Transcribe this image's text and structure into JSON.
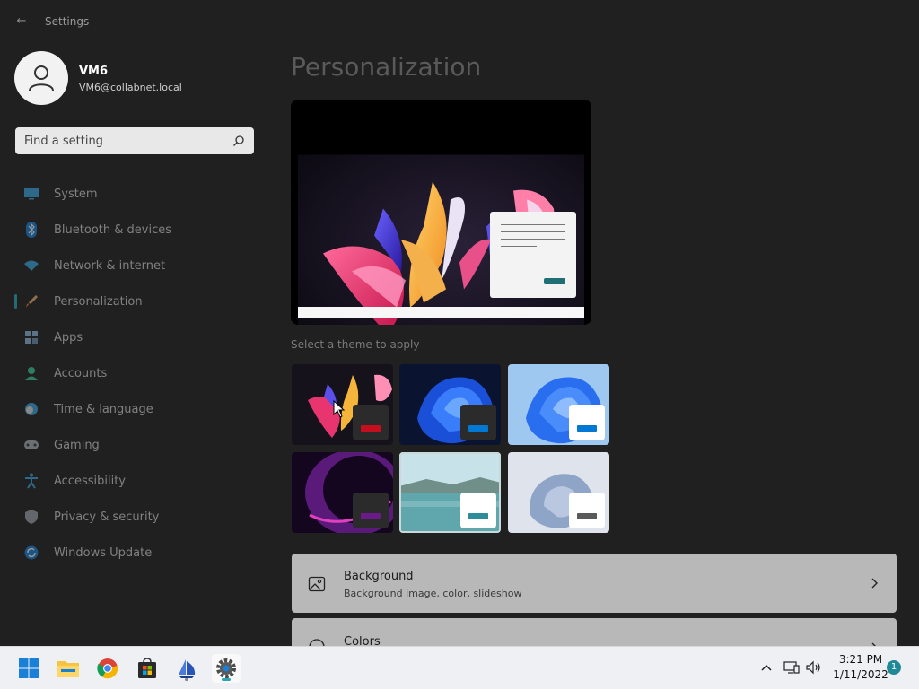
{
  "window": {
    "title": "Settings"
  },
  "account": {
    "name": "VM6",
    "email": "VM6@collabnet.local"
  },
  "search": {
    "placeholder": "Find a setting"
  },
  "nav": {
    "items": [
      {
        "label": "System",
        "icon": "monitor-icon"
      },
      {
        "label": "Bluetooth & devices",
        "icon": "bluetooth-icon"
      },
      {
        "label": "Network & internet",
        "icon": "wifi-icon"
      },
      {
        "label": "Personalization",
        "icon": "brush-icon",
        "active": true
      },
      {
        "label": "Apps",
        "icon": "apps-icon"
      },
      {
        "label": "Accounts",
        "icon": "person-icon"
      },
      {
        "label": "Time & language",
        "icon": "clock-globe-icon"
      },
      {
        "label": "Gaming",
        "icon": "gamepad-icon"
      },
      {
        "label": "Accessibility",
        "icon": "accessibility-icon"
      },
      {
        "label": "Privacy & security",
        "icon": "shield-icon"
      },
      {
        "label": "Windows Update",
        "icon": "update-icon"
      }
    ]
  },
  "main": {
    "title": "Personalization",
    "theme_heading": "Select a theme to apply",
    "themes": [
      {
        "name": "glow-dark",
        "chip_bg": "#2b2b2b",
        "accent": "#c50f1f"
      },
      {
        "name": "bloom-dark",
        "chip_bg": "#2b2b2b",
        "accent": "#0078d4"
      },
      {
        "name": "bloom-light",
        "chip_bg": "#ffffff",
        "accent": "#0078d4"
      },
      {
        "name": "captured-motion",
        "chip_bg": "#2b2b2b",
        "accent": "#6b1a8a"
      },
      {
        "name": "sunrise-lake",
        "chip_bg": "#ffffff",
        "accent": "#2d8c99",
        "selected": true
      },
      {
        "name": "flow",
        "chip_bg": "#ffffff",
        "accent": "#5a5a5a"
      }
    ],
    "cards": [
      {
        "title": "Background",
        "subtitle": "Background image, color, slideshow",
        "icon": "image-icon"
      },
      {
        "title": "Colors",
        "subtitle": "",
        "icon": "palette-icon"
      }
    ]
  },
  "taskbar": {
    "apps": [
      "start-icon",
      "file-explorer-icon",
      "chrome-icon",
      "store-icon",
      "sail-app-icon",
      "settings-icon"
    ],
    "time": "3:21 PM",
    "date": "1/11/2022",
    "notification_count": "1"
  },
  "colors": {
    "accent": "#2aa5b5",
    "background": "#202020",
    "card": "#b8b8b8",
    "taskbar": "#eef0f4"
  }
}
